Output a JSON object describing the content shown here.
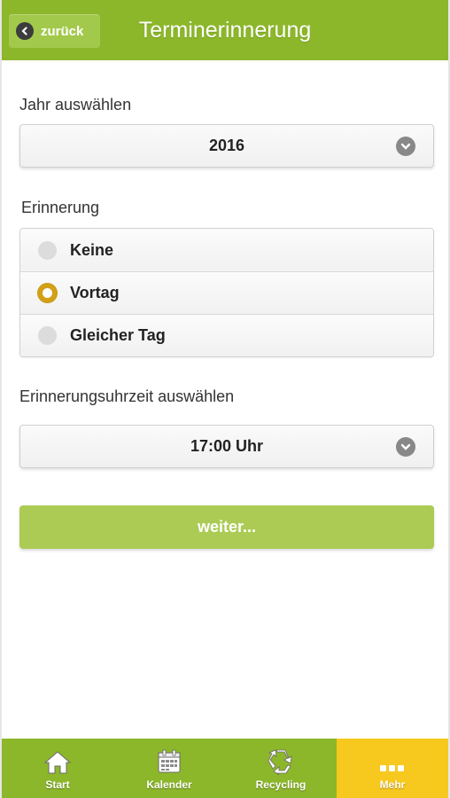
{
  "header": {
    "back_label": "zurück",
    "title": "Terminerinnerung"
  },
  "year": {
    "label": "Jahr auswählen",
    "selected": "2016"
  },
  "reminder": {
    "label": "Erinnerung",
    "options": [
      {
        "label": "Keine",
        "selected": false
      },
      {
        "label": "Vortag",
        "selected": true
      },
      {
        "label": "Gleicher Tag",
        "selected": false
      }
    ]
  },
  "time": {
    "label": "Erinnerungsuhrzeit auswählen",
    "selected": "17:00 Uhr"
  },
  "next_button": "weiter...",
  "tabs": [
    {
      "label": "Start",
      "icon": "home-icon",
      "active": false
    },
    {
      "label": "Kalender",
      "icon": "calendar-icon",
      "active": false
    },
    {
      "label": "Recycling",
      "icon": "recycle-icon",
      "active": false
    },
    {
      "label": "Mehr",
      "icon": "more-icon",
      "active": true
    }
  ],
  "colors": {
    "brand_green": "#8cb72a",
    "button_green": "#abcb54",
    "active_tab_yellow": "#f7c81e",
    "radio_selected": "#d4a017"
  }
}
